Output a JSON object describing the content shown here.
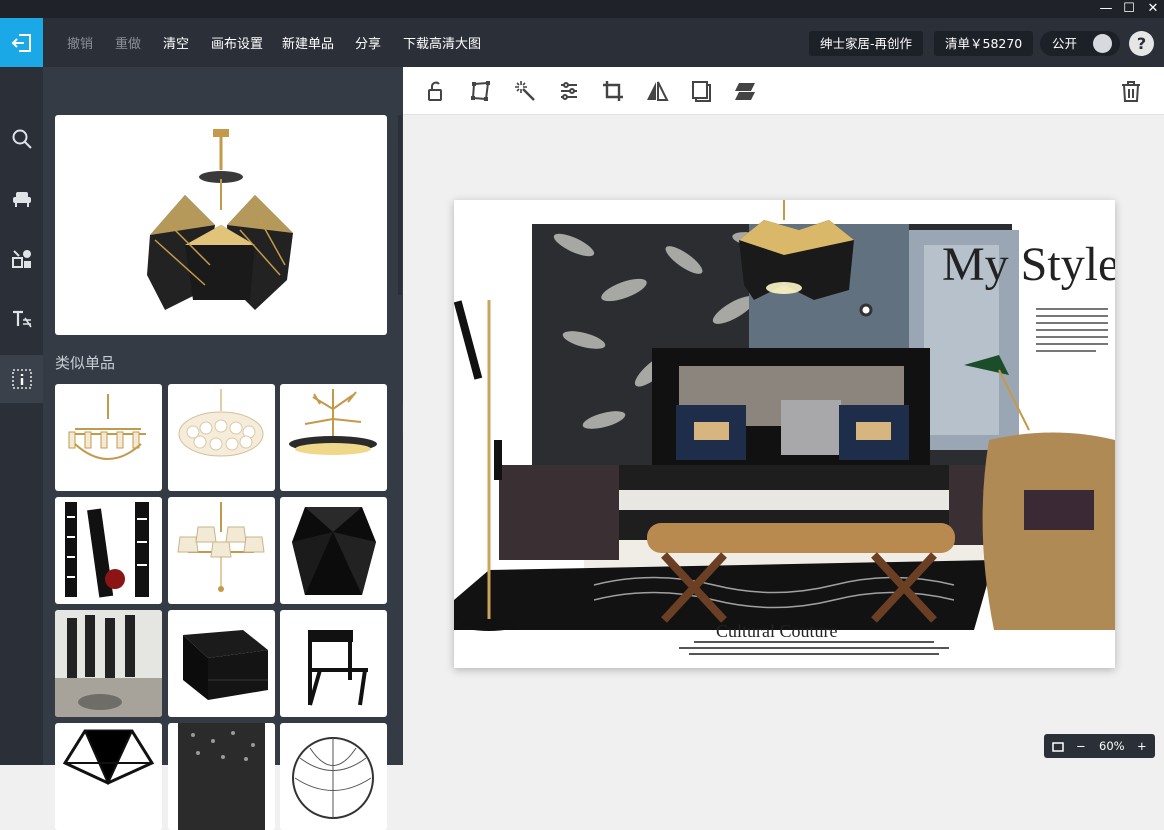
{
  "window": {
    "minimize": "—",
    "maximize": "☐",
    "close": "✕"
  },
  "header": {
    "menus": [
      "撤销",
      "重做",
      "清空",
      "画布设置",
      "新建单品",
      "分享",
      "下载高清大图"
    ],
    "project_name": "绅士家居-再创作",
    "price_label": "清单￥58270",
    "public_label": "公开",
    "help": "?"
  },
  "rail": {
    "icons": [
      "search-icon",
      "sofa-icon",
      "shapes-icon",
      "text-icon",
      "info-icon"
    ]
  },
  "panel": {
    "similar_title": "类似单品"
  },
  "board": {
    "headline": "My Style",
    "subhead": "Cultural Couture"
  },
  "zoom": {
    "value": "60%",
    "minus": "−",
    "plus": "+"
  },
  "colors": {
    "accent": "#1aa9e6",
    "header": "#2a2f38",
    "panel": "#353b45",
    "canvas": "#ffffff"
  }
}
